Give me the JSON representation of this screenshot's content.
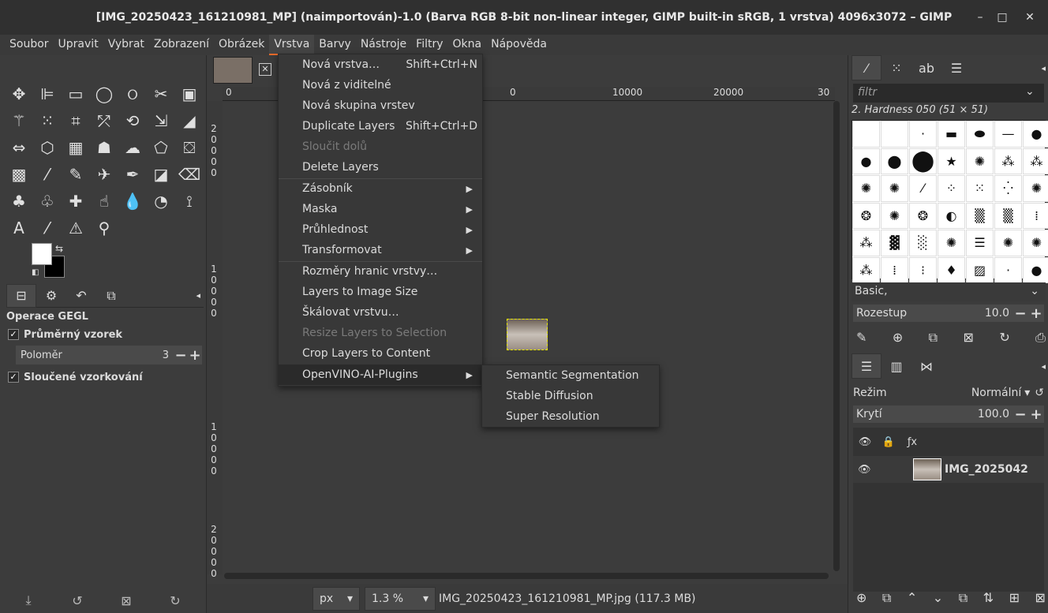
{
  "window": {
    "title": "[IMG_20250423_161210981_MP] (naimportován)-1.0 (Barva RGB 8-bit non-linear integer, GIMP built-in sRGB, 1 vrstva) 4096x3072 – GIMP",
    "minimize": "–",
    "maximize": "□",
    "close": "✕"
  },
  "menubar": [
    "Soubor",
    "Upravit",
    "Vybrat",
    "Zobrazení",
    "Obrázek",
    "Vrstva",
    "Barvy",
    "Nástroje",
    "Filtry",
    "Okna",
    "Nápověda"
  ],
  "active_menu": "Vrstva",
  "layer_menu": {
    "items": [
      {
        "label": "Nová vrstva…",
        "accel": "Shift+Ctrl+N",
        "enabled": true
      },
      {
        "label": "Nová z viditelné",
        "accel": "",
        "enabled": true
      },
      {
        "label": "Nová skupina vrstev",
        "accel": "",
        "enabled": true
      },
      {
        "label": "Duplicate Layers",
        "accel": "Shift+Ctrl+D",
        "enabled": true
      },
      {
        "label": "Sloučit dolů",
        "accel": "",
        "enabled": false
      },
      {
        "label": "Delete Layers",
        "accel": "",
        "enabled": true
      },
      {
        "label": "Zásobník",
        "submenu": true,
        "enabled": true
      },
      {
        "label": "Maska",
        "submenu": true,
        "enabled": true
      },
      {
        "label": "Průhlednost",
        "submenu": true,
        "enabled": true
      },
      {
        "label": "Transformovat",
        "submenu": true,
        "enabled": true
      },
      {
        "label": "Rozměry hranic vrstvy…",
        "enabled": true
      },
      {
        "label": "Layers to Image Size",
        "enabled": true
      },
      {
        "label": "Škálovat vrstvu…",
        "enabled": true
      },
      {
        "label": "Resize Layers to Selection",
        "enabled": false
      },
      {
        "label": "Crop Layers to Content",
        "enabled": true
      },
      {
        "label": "OpenVINO-AI-Plugins",
        "submenu": true,
        "enabled": true,
        "highlighted": true
      }
    ]
  },
  "openvino_submenu": [
    "Semantic Segmentation",
    "Stable Diffusion",
    "Super Resolution"
  ],
  "toolbox": {
    "tool_options_title": "Operace GEGL",
    "average_sample": "Průměrný vzorek",
    "radius_label": "Poloměr",
    "radius_value": "3",
    "merged_sampling": "Sloučené vzorkování"
  },
  "canvas": {
    "hruler_ticks": [
      "0",
      "10000",
      "20000",
      "30"
    ],
    "vruler_labels": [
      "2\n0\n0\n0\n0",
      "1\n0\n0\n0\n0",
      "1\n0\n0\n0\n0",
      "2\n0\n0\n0\n0"
    ],
    "unit": "px",
    "zoom": "1.3 %",
    "status_text": "IMG_20250423_161210981_MP.jpg (117.3 MB)"
  },
  "brushes": {
    "filter_placeholder": "filtr",
    "selected_brush": "2. Hardness 050 (51 × 51)",
    "preset": "Basic,",
    "spacing_label": "Rozestup",
    "spacing_value": "10.0"
  },
  "layers": {
    "mode_label": "Režim",
    "mode_value": "Normální",
    "opacity_label": "Krytí",
    "opacity_value": "100.0",
    "layer_name": "IMG_2025042"
  }
}
